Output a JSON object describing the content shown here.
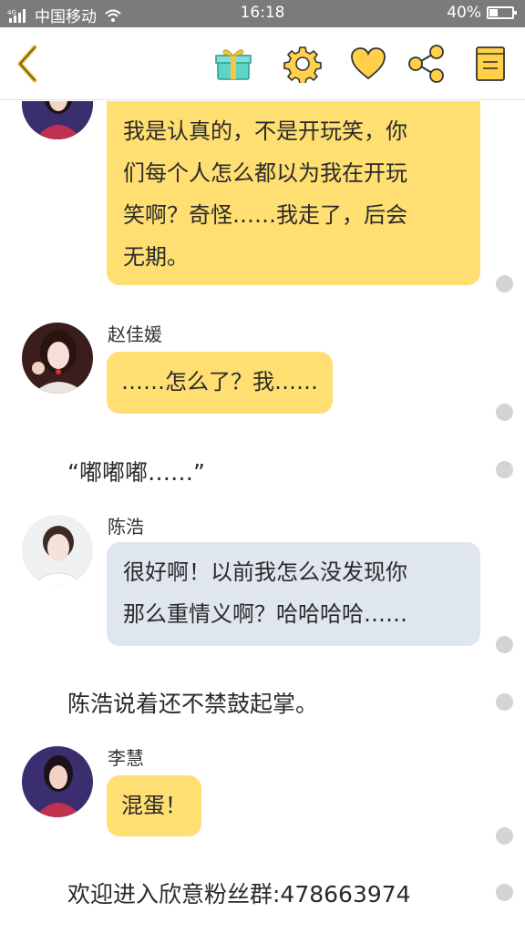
{
  "status_bar": {
    "network_label": "4G",
    "carrier": "中国移动",
    "time": "16:18",
    "battery_percent": "40%",
    "battery_level": 0.4
  },
  "toolbar": {
    "icons": [
      "back-arrow-icon",
      "gift-icon",
      "gear-icon",
      "heart-icon",
      "share-icon",
      "book-icon"
    ],
    "accent_color": "#f2c94c"
  },
  "messages": [
    {
      "type": "bubble",
      "speaker": "",
      "style": "yellow",
      "text": "我是认真的，不是开玩笑，你们每个人怎么都以为我在开玩笑啊？奇怪……我走了，后会无期。",
      "lines": [
        "我是认真的，不是开玩笑，你",
        "们每个人怎么都以为我在开玩",
        "笑啊？奇怪……我走了，后会",
        "无期。"
      ]
    },
    {
      "type": "bubble",
      "speaker": "赵佳媛",
      "style": "yellow",
      "lines": [
        "……怎么了？我……"
      ]
    },
    {
      "type": "narration",
      "text": "“嘟嘟嘟……”"
    },
    {
      "type": "bubble",
      "speaker": "陈浩",
      "style": "blue",
      "lines": [
        "很好啊！以前我怎么没发现你",
        "那么重情义啊？哈哈哈哈……"
      ]
    },
    {
      "type": "narration",
      "text": "陈浩说着还不禁鼓起掌。"
    },
    {
      "type": "bubble",
      "speaker": "李慧",
      "style": "yellow",
      "lines": [
        "混蛋！"
      ]
    },
    {
      "type": "narration",
      "text": "欢迎进入欣意粉丝群:478663974"
    }
  ],
  "colors": {
    "bubble_yellow": "#ffdf72",
    "bubble_blue": "#dfe6ef",
    "status_bar": "#7b7b7b"
  }
}
